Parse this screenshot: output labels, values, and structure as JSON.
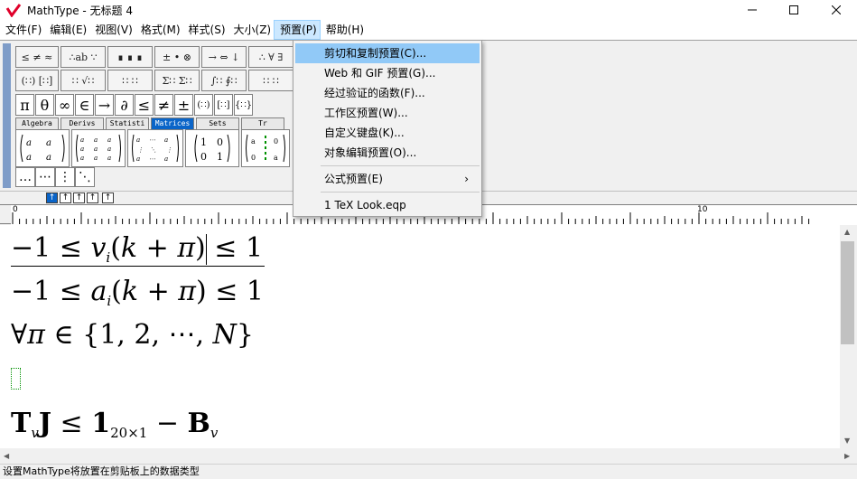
{
  "window": {
    "title": "MathType - 无标题 4",
    "accent": "#e0002a"
  },
  "menubar": {
    "items": [
      {
        "label": "文件(F)"
      },
      {
        "label": "编辑(E)"
      },
      {
        "label": "视图(V)"
      },
      {
        "label": "格式(M)"
      },
      {
        "label": "样式(S)"
      },
      {
        "label": "大小(Z)"
      },
      {
        "label": "预置(P)"
      },
      {
        "label": "帮助(H)"
      }
    ],
    "active_index": 6
  },
  "toolbar": {
    "row1": [
      "≤ ≠ ≈",
      "∴ab ∵",
      "∎ ∎ ∎",
      "± • ⊗",
      "→ ⇔ ↓",
      "∴ ∀ ∃"
    ],
    "row2": [
      "(∷) [∷]",
      "∷ √∷",
      "∷ ∷",
      "Σ∷ Σ∷",
      "∫∷ ∮∷",
      "∷ ∷"
    ],
    "symbols": [
      "π",
      "θ",
      "∞",
      "∈",
      "→",
      "∂",
      "≤",
      "≠",
      "±",
      "(∷)",
      "[∷]",
      "{∷}"
    ],
    "tabs": [
      "Algebra",
      "Derivs",
      "Statisti",
      "Matrices",
      "Sets",
      "Tr"
    ],
    "active_tab": "Matrices",
    "small": [
      "…",
      "⋯",
      "⋮",
      "⋱"
    ]
  },
  "ruler": {
    "labels": [
      "0",
      "10"
    ]
  },
  "statusbar": {
    "text": "设置MathType将放置在剪贴板上的数据类型"
  },
  "dropdown": {
    "items": [
      {
        "label": "剪切和复制预置(C)..."
      },
      {
        "label": "Web 和 GIF 预置(G)..."
      },
      {
        "label": "经过验证的函数(F)..."
      },
      {
        "label": "工作区预置(W)..."
      },
      {
        "label": "自定义键盘(K)..."
      },
      {
        "label": "对象编辑预置(O)..."
      },
      {
        "label": "公式预置(E)",
        "submenu_glyph": "›"
      },
      {
        "label": "1 TeX Look.eqp"
      }
    ],
    "highlighted_index": 0
  }
}
